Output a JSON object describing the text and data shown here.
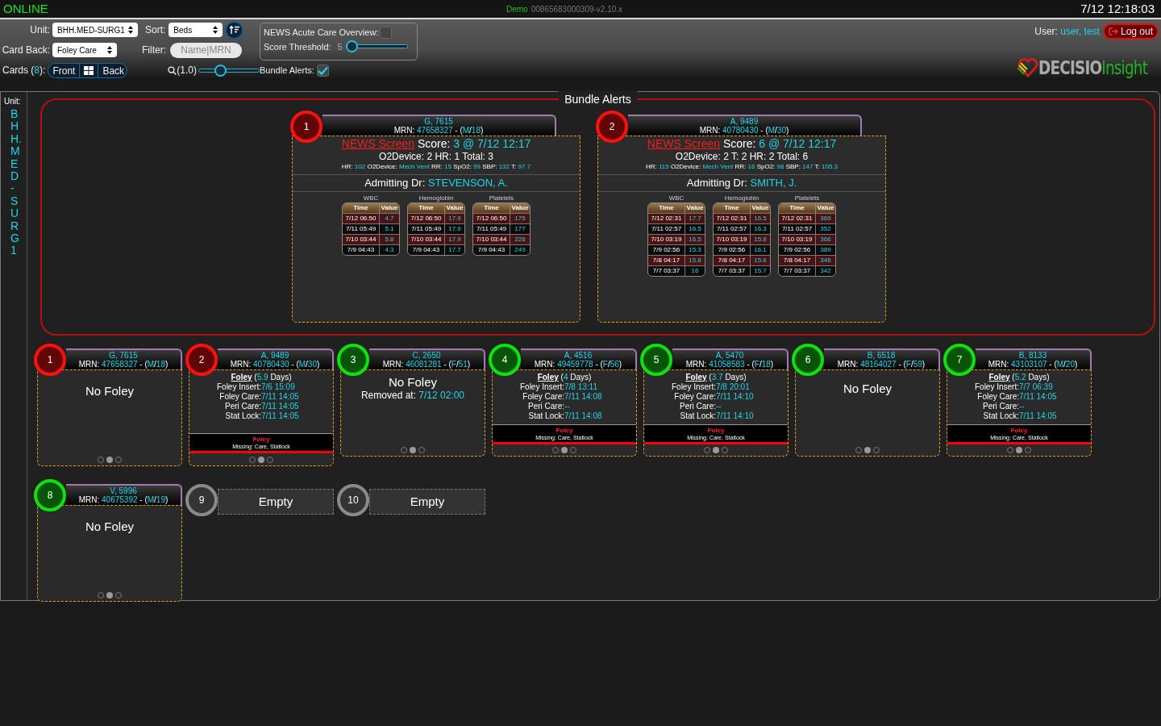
{
  "status_bar": {
    "connection": "ONLINE",
    "demo_label": "Demo",
    "build": "00865683000309-v2.10.x",
    "clock": "7/12 12:18:03"
  },
  "toolbar": {
    "unit_label": "Unit:",
    "unit": "BHH.MED-SURG1",
    "sort_label": "Sort:",
    "sort": "Beds",
    "card_back_label": "Card Back:",
    "card_back": "Foley Care",
    "filter_label": "Filter:",
    "filter_placeholder": "Name|MRN",
    "cards_label": [
      "Cards (",
      "8",
      "):"
    ],
    "view_buttons": [
      "Front",
      "Back"
    ],
    "zoom_label": "(1.0)",
    "zoom": {
      "level": 0.35
    },
    "news": {
      "label": "NEWS Acute Care Overview:",
      "checked": false,
      "threshold_label": "Score Threshold:",
      "threshold": "5",
      "level": 0.08
    },
    "bundle_alerts": {
      "label": "Bundle Alerts:",
      "checked": true
    },
    "user_label": "User:",
    "user": "user, test",
    "logout": "Log out",
    "logo": [
      "DECISIO",
      "Insight"
    ]
  },
  "sidebar": {
    "label": "Unit:",
    "unit": "BHH.MED-SURG1"
  },
  "bundle_alerts": {
    "title": "Bundle Alerts",
    "cards": [
      {
        "number": "1",
        "color": "#ff1010",
        "name": "G, 7615",
        "mrn": [
          "MRN: ",
          "47658327",
          " - (",
          "M",
          "/",
          "18",
          ")"
        ],
        "news_link": "NEWS Screen",
        "score": [
          " Score: ",
          "3 @ 7/12 12:17"
        ],
        "breakdown": "O2Device: 2 HR: 1 Total: 3",
        "vitals": [
          "HR: ",
          "102",
          " O2Device: ",
          "Mech Vent",
          " RR: ",
          "15",
          " SpO2: ",
          "99",
          " SBP: ",
          "132",
          " T: ",
          "97.7"
        ],
        "admitting": [
          "Admitting Dr: ",
          "STEVENSON, A."
        ],
        "labs": [
          {
            "name": "WBC",
            "columns": [
              "Time",
              "Value"
            ],
            "rows": [
              [
                "7/12 06:50",
                "4.7"
              ],
              [
                "7/11 05:49",
                "5.1"
              ],
              [
                "7/10 03:44",
                "5.8"
              ],
              [
                "7/9 04:43",
                "4.3"
              ]
            ]
          },
          {
            "name": "Hemoglobin",
            "columns": [
              "Time",
              "Value"
            ],
            "rows": [
              [
                "7/12 06:50",
                "17.9"
              ],
              [
                "7/11 05:49",
                "17.9"
              ],
              [
                "7/10 03:44",
                "17.9"
              ],
              [
                "7/9 04:43",
                "17.7"
              ]
            ]
          },
          {
            "name": "Platelets",
            "columns": [
              "Time",
              "Value"
            ],
            "rows": [
              [
                "7/12 06:50",
                "175"
              ],
              [
                "7/11 05:49",
                "177"
              ],
              [
                "7/10 03:44",
                "226"
              ],
              [
                "7/9 04:43",
                "249"
              ]
            ]
          }
        ]
      },
      {
        "number": "2",
        "color": "#ff1010",
        "name": "A, 9489",
        "mrn": [
          "MRN: ",
          "40780430",
          " - (",
          "M",
          "/",
          "30",
          ")"
        ],
        "news_link": "NEWS Screen",
        "score": [
          " Score: ",
          "6 @ 7/12 12:17"
        ],
        "breakdown": "O2Device: 2 T: 2 HR: 2 Total: 6",
        "vitals": [
          "HR: ",
          "115",
          " O2Device: ",
          "Mech Vent",
          " RR: ",
          "16",
          " SpO2: ",
          "98",
          " SBP: ",
          "147",
          " T: ",
          "105.3"
        ],
        "admitting": [
          "Admitting Dr: ",
          "SMITH, J."
        ],
        "labs": [
          {
            "name": "WBC",
            "columns": [
              "Time",
              "Value"
            ],
            "rows": [
              [
                "7/12 02:31",
                "17.7"
              ],
              [
                "7/11 02:57",
                "16.5"
              ],
              [
                "7/10 03:19",
                "16.5"
              ],
              [
                "7/9 02:56",
                "15.3"
              ],
              [
                "7/8 04:17",
                "15.8"
              ],
              [
                "7/7 03:37",
                "16"
              ]
            ]
          },
          {
            "name": "Hemoglobin",
            "columns": [
              "Time",
              "Value"
            ],
            "rows": [
              [
                "7/12 02:31",
                "16.5"
              ],
              [
                "7/11 02:57",
                "16.3"
              ],
              [
                "7/10 03:19",
                "15.8"
              ],
              [
                "7/9 02:56",
                "16.1"
              ],
              [
                "7/8 04:17",
                "15.6"
              ],
              [
                "7/7 03:37",
                "15.7"
              ]
            ]
          },
          {
            "name": "Platelets",
            "columns": [
              "Time",
              "Value"
            ],
            "rows": [
              [
                "7/12 02:31",
                "369"
              ],
              [
                "7/11 02:57",
                "352"
              ],
              [
                "7/10 03:19",
                "366"
              ],
              [
                "7/9 02:56",
                "389"
              ],
              [
                "7/8 04:17",
                "346"
              ],
              [
                "7/7 03:37",
                "342"
              ]
            ]
          }
        ]
      }
    ]
  },
  "beds": [
    {
      "number": "1",
      "color": "#ff1010",
      "kind": "patient",
      "name": "G, 7615",
      "mrn": [
        "MRN: ",
        "47658327",
        " - (",
        "M",
        "/",
        "18",
        ")"
      ],
      "body": {
        "kind": "no_foley",
        "title": "No Foley"
      },
      "pages": [
        {
          "selected": false
        },
        {
          "selected": true
        },
        {
          "selected": false
        }
      ]
    },
    {
      "number": "2",
      "color": "#ff1010",
      "kind": "patient",
      "name": "A, 9489",
      "mrn": [
        "MRN: ",
        "40780430",
        " - (",
        "M",
        "/",
        "30",
        ")"
      ],
      "body": {
        "kind": "foley",
        "title": "Foley",
        "duration": [
          " (",
          "5.9",
          " Days)"
        ],
        "fields": [
          [
            "Foley Insert: ",
            "7/6 15:09"
          ],
          [
            "Foley Care: ",
            "7/11 14:05"
          ],
          [
            "Peri Care: ",
            "7/11 14:05"
          ],
          [
            "Stat Lock: ",
            "7/11 14:05"
          ]
        ],
        "alert": {
          "title": "Foley",
          "text": "Missing: Care, Statlock"
        }
      },
      "pages": [
        {
          "selected": false
        },
        {
          "selected": true
        },
        {
          "selected": false
        }
      ]
    },
    {
      "number": "3",
      "color": "#10e010",
      "kind": "patient",
      "name": "C, 2650",
      "mrn": [
        "MRN: ",
        "46081281",
        " - (",
        "F",
        "/",
        "51",
        ")"
      ],
      "body": {
        "kind": "removed",
        "title": "No Foley",
        "removed": [
          "Removed at: ",
          "7/12 02:00"
        ]
      },
      "pages": [
        {
          "selected": false
        },
        {
          "selected": true
        },
        {
          "selected": false
        }
      ]
    },
    {
      "number": "4",
      "color": "#10e010",
      "kind": "patient",
      "name": "A, 4516",
      "mrn": [
        "MRN: ",
        "49459778",
        " - (",
        "F",
        "/",
        "56",
        ")"
      ],
      "body": {
        "kind": "foley",
        "title": "Foley",
        "duration": [
          " (",
          "4",
          " Days)"
        ],
        "fields": [
          [
            "Foley Insert: ",
            "7/8 13:11"
          ],
          [
            "Foley Care: ",
            "7/11 14:08"
          ],
          [
            "Peri Care: ",
            "--"
          ],
          [
            "Stat Lock: ",
            "7/11 14:08"
          ]
        ],
        "alert": {
          "title": "Foley",
          "text": "Missing: Care, Statlock"
        }
      },
      "pages": [
        {
          "selected": false
        },
        {
          "selected": true
        },
        {
          "selected": false
        }
      ]
    },
    {
      "number": "5",
      "color": "#10e010",
      "kind": "patient",
      "name": "A, 5470",
      "mrn": [
        "MRN: ",
        "41058583",
        " - (",
        "F",
        "/",
        "18",
        ")"
      ],
      "body": {
        "kind": "foley",
        "title": "Foley",
        "duration": [
          " (",
          "3.7",
          " Days)"
        ],
        "fields": [
          [
            "Foley Insert: ",
            "7/8 20:01"
          ],
          [
            "Foley Care: ",
            "7/11 14:10"
          ],
          [
            "Peri Care: ",
            "--"
          ],
          [
            "Stat Lock: ",
            "7/11 14:10"
          ]
        ],
        "alert": {
          "title": "Foley",
          "text": "Missing: Care, Statlock"
        }
      },
      "pages": [
        {
          "selected": false
        },
        {
          "selected": true
        },
        {
          "selected": false
        }
      ]
    },
    {
      "number": "6",
      "color": "#10e010",
      "kind": "patient",
      "name": "B, 6518",
      "mrn": [
        "MRN: ",
        "48164027",
        " - (",
        "F",
        "/",
        "59",
        ")"
      ],
      "body": {
        "kind": "no_foley",
        "title": "No Foley"
      },
      "pages": [
        {
          "selected": false
        },
        {
          "selected": true
        },
        {
          "selected": false
        }
      ]
    },
    {
      "number": "7",
      "color": "#10e010",
      "kind": "patient",
      "name": "B, 8133",
      "mrn": [
        "MRN: ",
        "43103107",
        " - (",
        "M",
        "/",
        "20",
        ")"
      ],
      "body": {
        "kind": "foley",
        "title": "Foley",
        "duration": [
          " (",
          "5.2",
          " Days)"
        ],
        "fields": [
          [
            "Foley Insert: ",
            "7/7 06:39"
          ],
          [
            "Foley Care: ",
            "7/11 14:05"
          ],
          [
            "Peri Care: ",
            "--"
          ],
          [
            "Stat Lock: ",
            "7/11 14:05"
          ]
        ],
        "alert": {
          "title": "Foley",
          "text": "Missing: Care, Statlock"
        }
      },
      "pages": [
        {
          "selected": false
        },
        {
          "selected": true
        },
        {
          "selected": false
        }
      ]
    },
    {
      "number": "8",
      "color": "#10e010",
      "kind": "patient",
      "name": "V, 5996",
      "mrn": [
        "MRN: ",
        "40675392",
        " - (",
        "M",
        "/",
        "19",
        ")"
      ],
      "body": {
        "kind": "no_foley",
        "title": "No Foley"
      },
      "pages": [
        {
          "selected": false
        },
        {
          "selected": true
        },
        {
          "selected": false
        }
      ]
    },
    {
      "number": "9",
      "color": "#8a8a8a",
      "kind": "empty",
      "label": "Empty"
    },
    {
      "number": "10",
      "color": "#8a8a8a",
      "kind": "empty",
      "label": "Empty"
    }
  ]
}
